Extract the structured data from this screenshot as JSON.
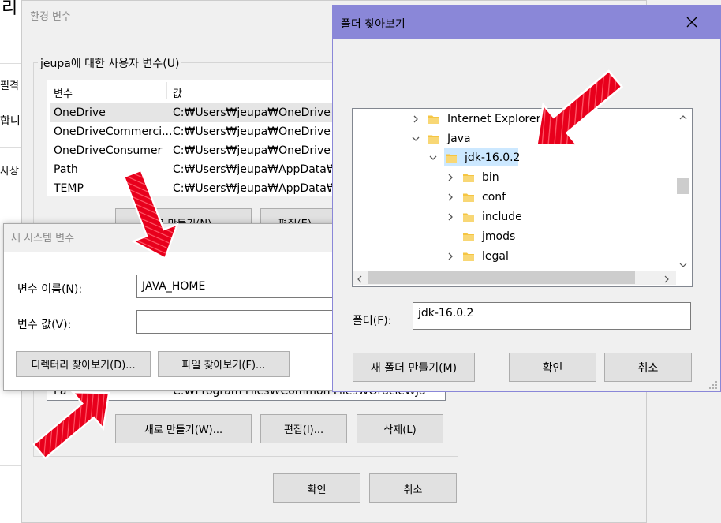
{
  "bg_window": {
    "title_fragment": "리",
    "left_items": [
      "필격",
      "합니",
      "사상"
    ]
  },
  "env_dialog": {
    "title": "환경 변수",
    "user_group_label": "jeupa에 대한 사용자 변수(U)",
    "columns": [
      "변수",
      "값"
    ],
    "rows": [
      {
        "name": "OneDrive",
        "value": "C:₩Users₩jeupa₩OneDrive - ..."
      },
      {
        "name": "OneDriveCommerci...",
        "value": "C:₩Users₩jeupa₩OneDrive - ..."
      },
      {
        "name": "OneDriveConsumer",
        "value": "C:₩Users₩jeupa₩OneDrive"
      },
      {
        "name": "Path",
        "value": "C:₩Users₩jeupa₩AppData₩Lo"
      },
      {
        "name": "TEMP",
        "value": "C:₩Users₩jeupa₩AppData₩Lo"
      }
    ],
    "user_new_label": "새로 만들기(N)...",
    "user_edit_label": "편집(E)...",
    "sys_partial_row": {
      "name": "Pa",
      "value": "C:₩Program Files₩Common Files₩Oracle₩Ja"
    },
    "sys_new_label": "새로 만들기(W)...",
    "sys_edit_label": "편집(I)...",
    "sys_delete_label": "삭제(L)",
    "ok_label": "확인",
    "cancel_label": "취소"
  },
  "new_sys_var_dialog": {
    "title": "새 시스템 변수",
    "name_label": "변수 이름(N):",
    "name_value": "JAVA_HOME",
    "value_label": "변수 값(V):",
    "value_value": "",
    "browse_dir_label": "디렉터리 찾아보기(D)...",
    "browse_file_label": "파일 찾아보기(F)..."
  },
  "folder_dialog": {
    "title": "폴더 찾아보기",
    "close_icon": "close-icon",
    "tree": [
      {
        "label": "Internet Explorer",
        "level": 0,
        "expander": "collapsed",
        "selected": false
      },
      {
        "label": "Java",
        "level": 0,
        "expander": "expanded",
        "selected": false
      },
      {
        "label": "jdk-16.0.2",
        "level": 1,
        "expander": "expanded",
        "selected": true
      },
      {
        "label": "bin",
        "level": 2,
        "expander": "collapsed",
        "selected": false
      },
      {
        "label": "conf",
        "level": 2,
        "expander": "collapsed",
        "selected": false
      },
      {
        "label": "include",
        "level": 2,
        "expander": "collapsed",
        "selected": false
      },
      {
        "label": "jmods",
        "level": 2,
        "expander": "none",
        "selected": false
      },
      {
        "label": "legal",
        "level": 2,
        "expander": "collapsed",
        "selected": false
      }
    ],
    "folder_label": "폴더(F):",
    "folder_value": "jdk-16.0.2",
    "new_folder_label": "새 폴더 만들기(M)",
    "ok_label": "확인",
    "cancel_label": "취소"
  },
  "colors": {
    "titlebar_active": "#8a87d8",
    "selection": "#cce8ff",
    "arrow": "#e8001c",
    "folder": "#f5c542"
  }
}
